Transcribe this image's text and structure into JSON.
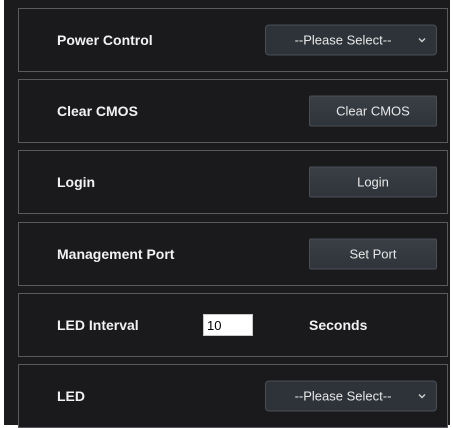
{
  "rows": {
    "power_control": {
      "label": "Power Control",
      "select_value": "--Please Select--",
      "chevron_icon": "chevron-down-icon"
    },
    "clear_cmos": {
      "label": "Clear CMOS",
      "button_label": "Clear CMOS"
    },
    "login": {
      "label": "Login",
      "button_label": "Login"
    },
    "management_port": {
      "label": "Management Port",
      "button_label": "Set Port"
    },
    "led_interval": {
      "label": "LED Interval",
      "value": "10",
      "unit": "Seconds"
    },
    "led": {
      "label": "LED",
      "select_value": "--Please Select--",
      "chevron_icon": "chevron-down-icon"
    }
  },
  "colors": {
    "panel_bg": "#1b1b1d",
    "row_border": "#5a5a5e",
    "button_bg": "#343940",
    "text": "#f2f2f2"
  }
}
